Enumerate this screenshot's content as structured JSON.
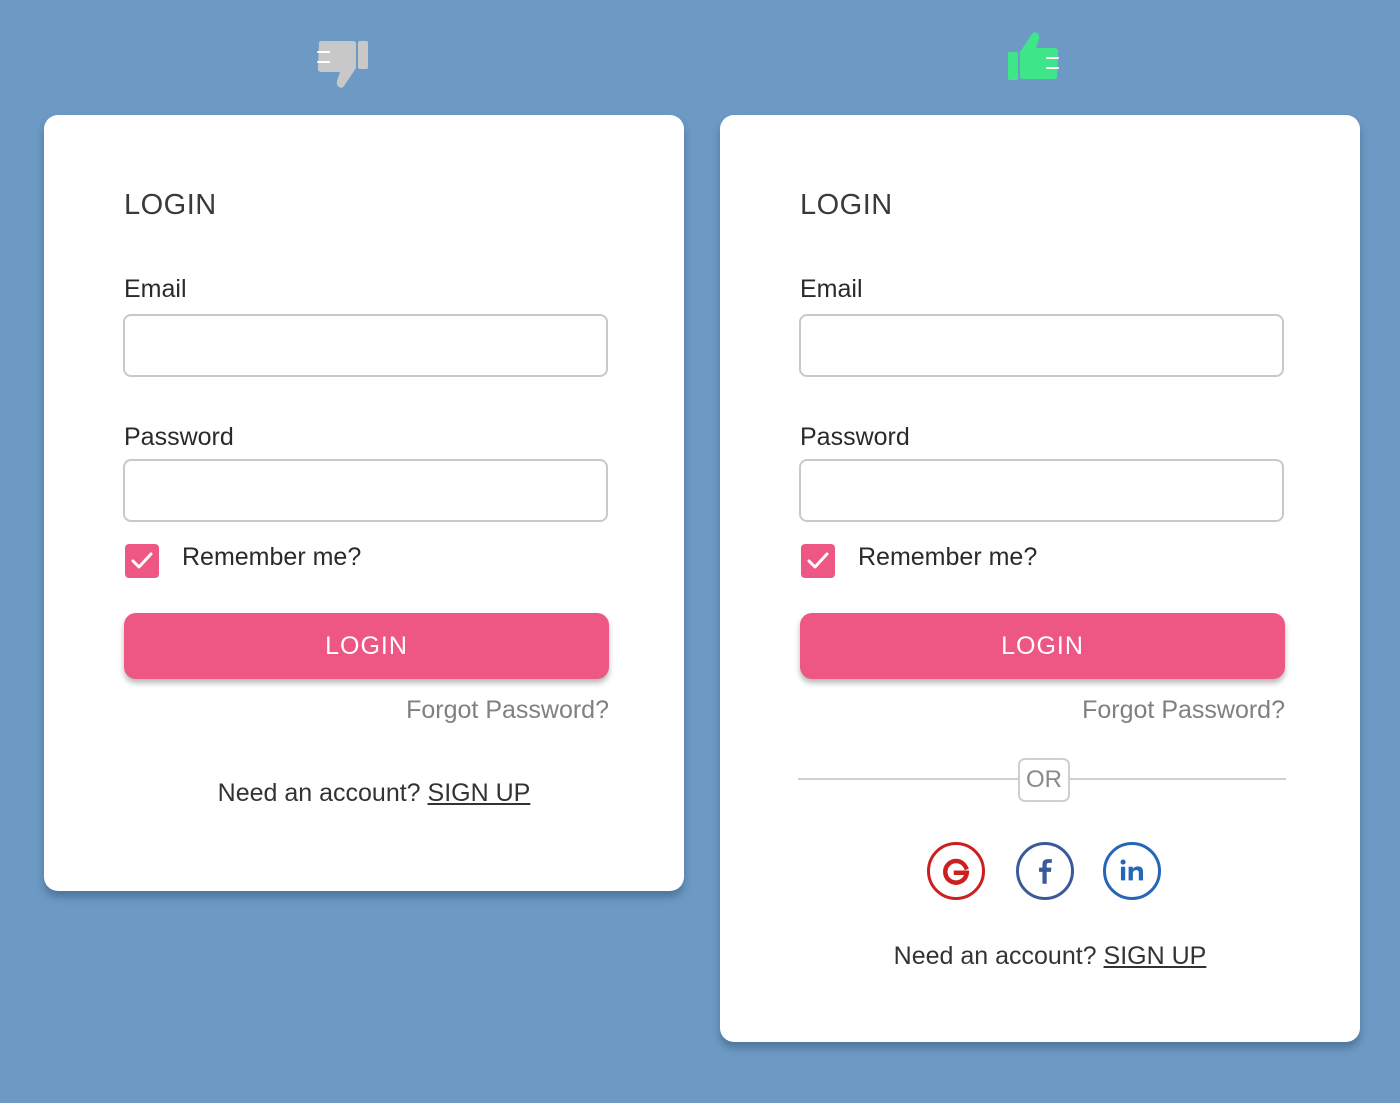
{
  "left_card": {
    "title": "LOGIN",
    "email_label": "Email",
    "email_value": "",
    "password_label": "Password",
    "password_value": "",
    "remember_label": "Remember me?",
    "remember_checked": true,
    "login_button": "LOGIN",
    "forgot_password": "Forgot Password?",
    "signup_prompt": "Need an account? ",
    "signup_link": "SIGN UP"
  },
  "right_card": {
    "title": "LOGIN",
    "email_label": "Email",
    "email_value": "",
    "password_label": "Password",
    "password_value": "",
    "remember_label": "Remember me?",
    "remember_checked": true,
    "login_button": "LOGIN",
    "forgot_password": "Forgot Password?",
    "divider_text": "OR",
    "social_icons": [
      "google-icon",
      "facebook-icon",
      "linkedin-icon"
    ],
    "signup_prompt": "Need an account? ",
    "signup_link": "SIGN UP"
  },
  "icons": {
    "left_indicator": "thumbs-down-icon",
    "right_indicator": "thumbs-up-icon"
  },
  "colors": {
    "background": "#6c9ac4",
    "accent": "#ee5684",
    "thumbs_down": "#c8c8c8",
    "thumbs_up": "#3ee68a",
    "google": "#cc1f1f",
    "facebook": "#3b5a9a",
    "linkedin": "#2466b8"
  }
}
